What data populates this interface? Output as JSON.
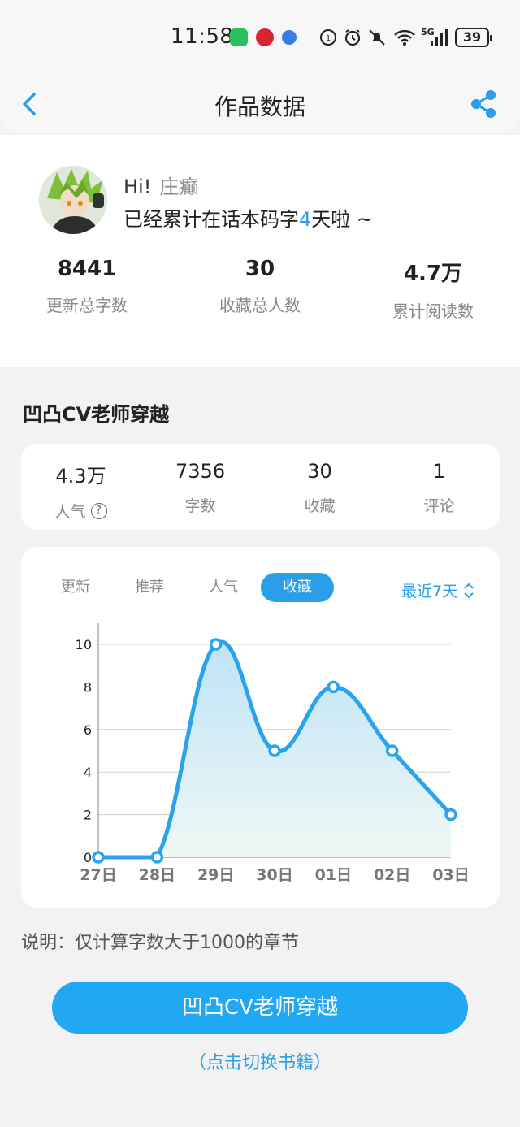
{
  "status_bar": {
    "time": "11:58",
    "battery": "39",
    "network": "5G"
  },
  "header": {
    "title": "作品数据"
  },
  "profile": {
    "greeting": "Hi!",
    "name": "庄癫",
    "slogan_prefix": "已经累计在话本码字",
    "days": "4",
    "slogan_suffix": "天啦 ~"
  },
  "stats": [
    {
      "value": "8441",
      "label": "更新总字数"
    },
    {
      "value": "30",
      "label": "收藏总人数"
    },
    {
      "value": "4.7万",
      "label": "累计阅读数"
    }
  ],
  "book": {
    "title": "凹凸CV老师穿越",
    "metrics": [
      {
        "value": "4.3万",
        "label": "人气",
        "help": "?"
      },
      {
        "value": "7356",
        "label": "字数"
      },
      {
        "value": "30",
        "label": "收藏"
      },
      {
        "value": "1",
        "label": "评论"
      }
    ]
  },
  "chart_tabs": [
    {
      "label": "更新",
      "active": false
    },
    {
      "label": "推荐",
      "active": false
    },
    {
      "label": "人气",
      "active": false
    },
    {
      "label": "收藏",
      "active": true
    }
  ],
  "range_selector": {
    "label": "最近7天"
  },
  "chart_data": {
    "type": "area",
    "categories": [
      "27日",
      "28日",
      "29日",
      "30日",
      "01日",
      "02日",
      "03日"
    ],
    "values": [
      0,
      0,
      10,
      5,
      8,
      5,
      2
    ],
    "ylim": [
      0,
      10
    ],
    "yticks": [
      0,
      2,
      4,
      6,
      8,
      10
    ],
    "grid": true,
    "colors": {
      "line": "#2aa3ee",
      "fill_top": "#bfe3f8",
      "fill_bottom": "#eef8f4"
    }
  },
  "note": "说明：仅计算字数大于1000的章节",
  "book_button": {
    "label": "凹凸CV老师穿越"
  },
  "switch_link": "（点击切换书籍）",
  "colors": {
    "accent": "#2a9ee8",
    "button": "#21a8f5"
  }
}
